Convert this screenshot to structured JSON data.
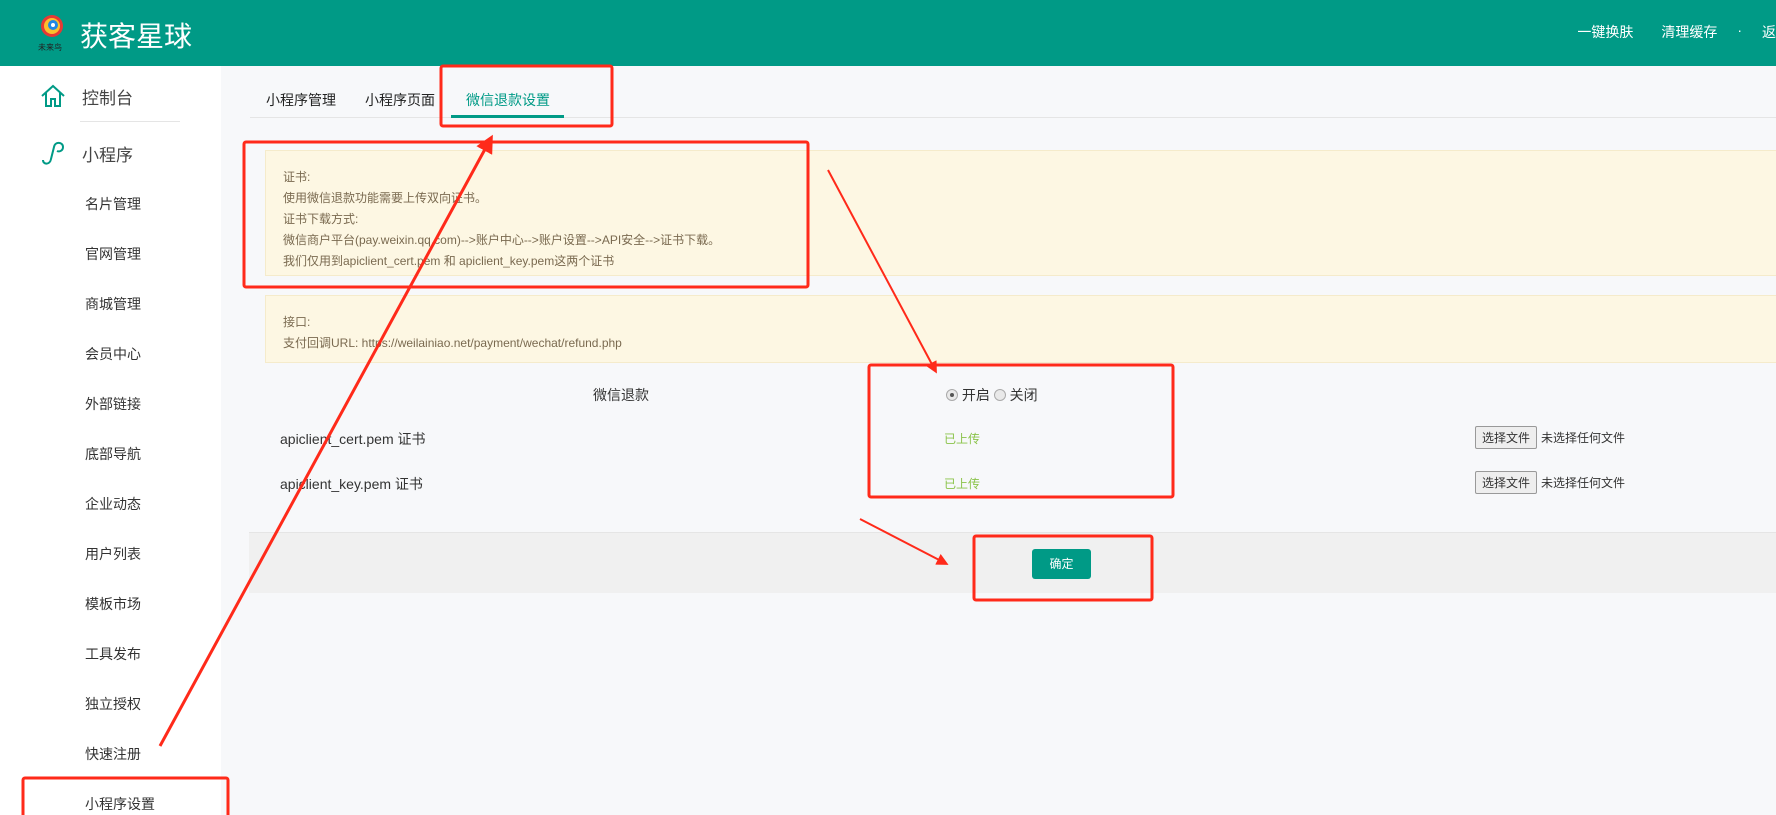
{
  "header": {
    "brand": "获客星球",
    "logo_text": "未来鸟",
    "links": [
      "一键换肤",
      "清理缓存",
      "·",
      "返"
    ]
  },
  "sidebar": {
    "dashboard": "控制台",
    "section": "小程序",
    "items": [
      "名片管理",
      "官网管理",
      "商城管理",
      "会员中心",
      "外部链接",
      "底部导航",
      "企业动态",
      "用户列表",
      "模板市场",
      "工具发布",
      "独立授权",
      "快速注册",
      "小程序设置"
    ]
  },
  "tabs": [
    "小程序管理",
    "小程序页面",
    "微信退款设置"
  ],
  "notice1": [
    "证书:",
    "使用微信退款功能需要上传双向证书。",
    "证书下载方式:",
    "微信商户平台(pay.weixin.qq.com)-->账户中心-->账户设置-->API安全-->证书下载。",
    "我们仅用到apiclient_cert.pem 和 apiclient_key.pem这两个证书"
  ],
  "notice2": [
    "接口:",
    "支付回调URL: https://weilainiao.net/payment/wechat/refund.php"
  ],
  "form": {
    "refund_label": "微信退款",
    "opt_on": "开启",
    "opt_off": "关闭",
    "cert_label": "apiclient_cert.pem 证书",
    "key_label": "apiclient_key.pem 证书",
    "uploaded": "已上传",
    "choose_file": "选择文件",
    "no_file": "未选择任何文件",
    "submit": "确定"
  },
  "colors": {
    "primary": "#009a86",
    "annotation": "#ff2a1a"
  }
}
